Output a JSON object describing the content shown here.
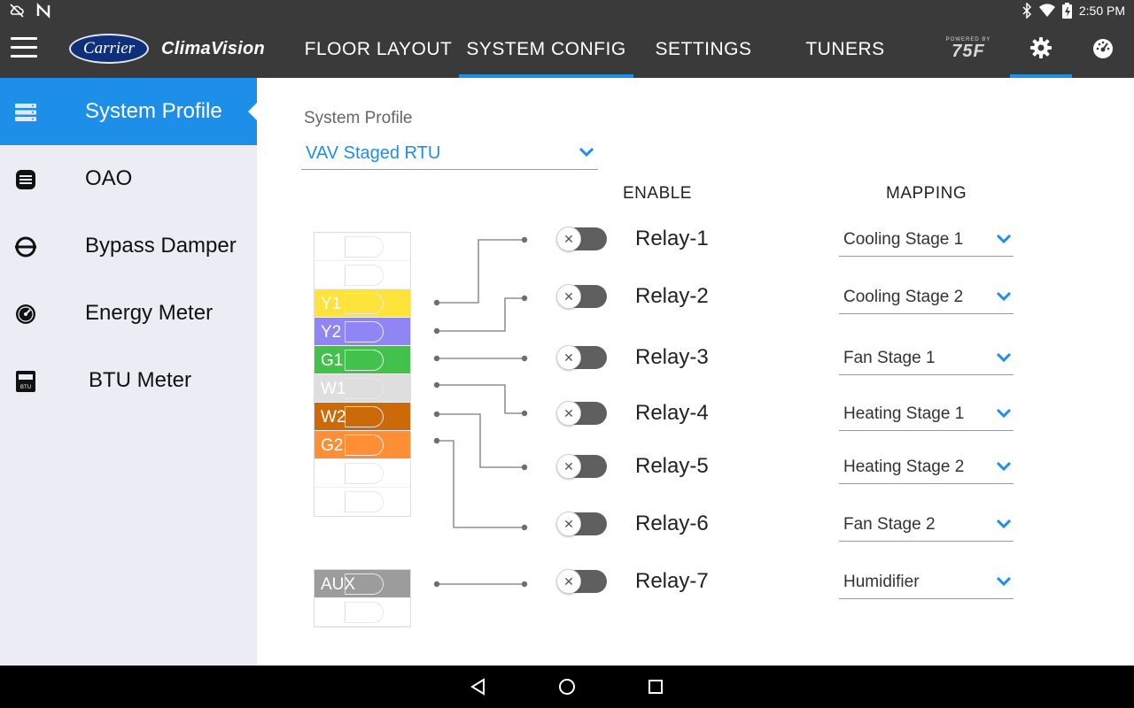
{
  "status_bar": {
    "time": "2:50 PM",
    "icons": [
      "cloud-off-icon",
      "n-icon",
      "bluetooth-icon",
      "wifi-icon",
      "battery-charging-icon"
    ]
  },
  "app_bar": {
    "brand_logo": "Carrier",
    "brand_name": "ClimaVision",
    "tabs": [
      {
        "label": "FLOOR LAYOUT",
        "active": false
      },
      {
        "label": "SYSTEM CONFIG",
        "active": true
      },
      {
        "label": "SETTINGS",
        "active": false
      },
      {
        "label": "TUNERS",
        "active": false
      }
    ],
    "powered_by_small": "POWERED BY",
    "powered_by_logo": "75F",
    "icons": [
      "menu-icon",
      "gear-icon",
      "dashboard-gauge-icon"
    ]
  },
  "sidebar": {
    "items": [
      {
        "label": "System Profile",
        "icon": "server-icon",
        "active": true
      },
      {
        "label": "OAO",
        "icon": "oao-icon",
        "active": false
      },
      {
        "label": "Bypass Damper",
        "icon": "damper-icon",
        "active": false
      },
      {
        "label": "Energy Meter",
        "icon": "meter-icon",
        "active": false
      },
      {
        "label": "BTU Meter",
        "icon": "btu-meter-icon",
        "active": false
      }
    ]
  },
  "main": {
    "profile_label": "System Profile",
    "profile_value": "VAV Staged RTU",
    "enable_header": "ENABLE",
    "mapping_header": "MAPPING",
    "terminals": {
      "rows": [
        "",
        "",
        "Y1",
        "Y2",
        "G1",
        "W1",
        "W2",
        "G2",
        "",
        ""
      ],
      "colors": {
        "Y1": "#fde33a",
        "Y2": "#8f85f5",
        "G1": "#42c24d",
        "W1": "#dedede",
        "W2": "#cc6a0a",
        "G2": "#ff8e34"
      },
      "aux_label": "AUX",
      "aux_color": "#9c9c9c"
    },
    "relays": [
      {
        "name": "Relay-1",
        "enabled": false,
        "mapping": "Cooling Stage 1"
      },
      {
        "name": "Relay-2",
        "enabled": false,
        "mapping": "Cooling Stage 2"
      },
      {
        "name": "Relay-3",
        "enabled": false,
        "mapping": "Fan Stage 1"
      },
      {
        "name": "Relay-4",
        "enabled": false,
        "mapping": "Heating Stage 1"
      },
      {
        "name": "Relay-5",
        "enabled": false,
        "mapping": "Heating Stage 2"
      },
      {
        "name": "Relay-6",
        "enabled": false,
        "mapping": "Fan Stage 2"
      },
      {
        "name": "Relay-7",
        "enabled": false,
        "mapping": "Humidifier"
      }
    ],
    "toggle_off_glyph": "✕"
  },
  "colors": {
    "accent": "#1e8fe8",
    "bar": "#3a3a3a",
    "sidebar_bg": "#ececf4",
    "toggle_track": "#5f5f5f"
  }
}
